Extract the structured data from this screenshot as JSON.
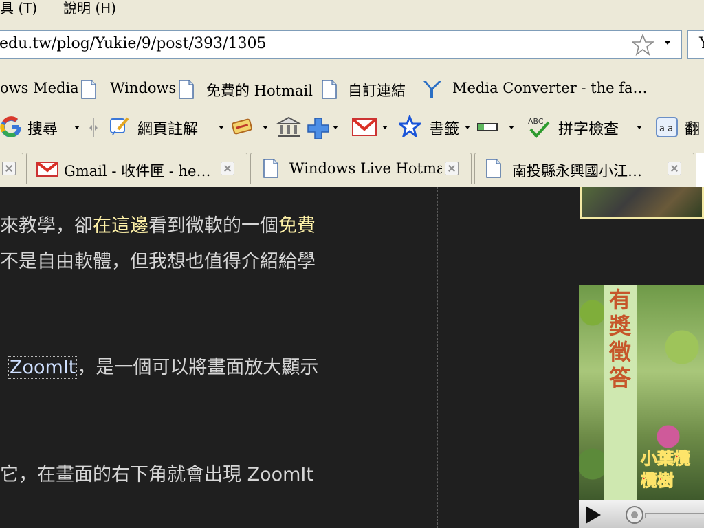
{
  "menubar": {
    "tools_label": "具 (T)",
    "help_label": "說明 (H)"
  },
  "address": {
    "url": "edu.tw/plog/Yukie/9/post/393/1305",
    "search_partial": "Y"
  },
  "bookmarks": [
    {
      "label": "ows Media"
    },
    {
      "label": "Windows"
    },
    {
      "label": "免費的 Hotmail"
    },
    {
      "label": "自訂連結"
    },
    {
      "label": "Media Converter - the fa…"
    }
  ],
  "google_toolbar": {
    "search_label": "搜尋",
    "annotate_label": "網頁註解",
    "bookmarks_label": "書籤",
    "spellcheck_label": "拼字檢查",
    "translate_label": "翻"
  },
  "tabs": [
    {
      "label": "Gmail - 收件匣 - he…"
    },
    {
      "label": "Windows Live Hotmail"
    },
    {
      "label": "南投縣永興國小江…"
    }
  ],
  "content": {
    "line1_a": "來教學，卻",
    "line1_hl1": "在這邊",
    "line1_b": "看到微軟的一個",
    "line1_hl2": "免費",
    "line2": "不是自由軟體，但我想也值得介紹給學",
    "line3_link": "ZoomIt",
    "line3_rest": "，是一個可以將畫面放大顯示",
    "line4": "它，在畫面的右下角就會出現 ZoomIt"
  },
  "sidebar": {
    "banner_text": "有獎徵答",
    "overlay_text_1": "小葉欖",
    "overlay_text_2": "欖樹"
  },
  "colors": {
    "content_bg": "#1f1f1f",
    "highlight": "#fff2a8",
    "chrome_bg": "#ece9d8"
  }
}
